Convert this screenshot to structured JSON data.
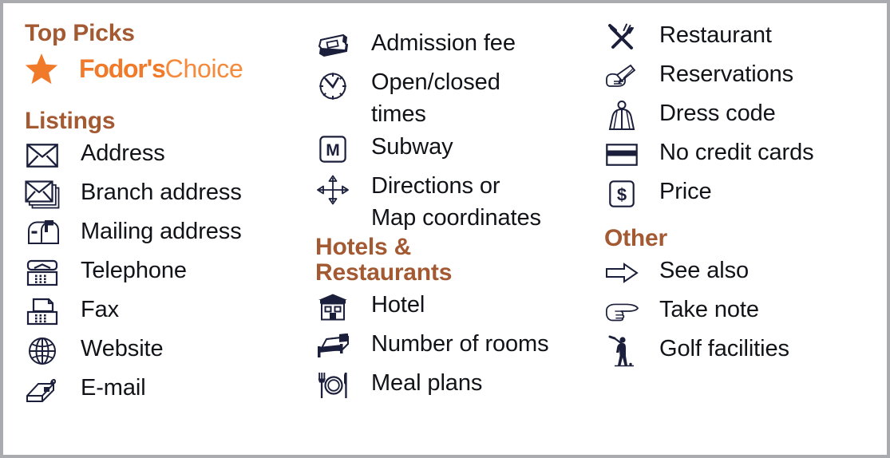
{
  "card": {
    "border_color": "#a9abaf",
    "background": "#ffffff",
    "heading_color": "#a35a32",
    "brand_orange": "#f1792a",
    "label_color": "#111318"
  },
  "columns": [
    {
      "id": "column-listings",
      "sections": [
        {
          "id": "top-picks",
          "title": "Top Picks",
          "brand": {
            "star_icon": "star-icon",
            "wordmark_bold": "Fodor's",
            "wordmark_light": "Choice"
          }
        },
        {
          "id": "listings",
          "title": "Listings",
          "items": [
            {
              "icon": "envelope-icon",
              "label": "Address"
            },
            {
              "icon": "envelope-stack-icon",
              "label": "Branch address"
            },
            {
              "icon": "mailbox-icon",
              "label": "Mailing address"
            },
            {
              "icon": "telephone-icon",
              "label": "Telephone"
            },
            {
              "icon": "fax-machine-icon",
              "label": "Fax"
            },
            {
              "icon": "globe-icon",
              "label": "Website"
            },
            {
              "icon": "computer-mouse-icon",
              "label": "E-mail"
            }
          ]
        }
      ]
    },
    {
      "id": "column-sights",
      "sections": [
        {
          "id": "sights",
          "title": "",
          "items": [
            {
              "icon": "ticket-icon",
              "label": "Admission fee"
            },
            {
              "icon": "clock-icon",
              "label": "Open/closed\ntimes"
            },
            {
              "icon": "subway-m-icon",
              "label": "Subway"
            },
            {
              "icon": "four-way-arrow-icon",
              "label": "Directions or\nMap coordinates"
            }
          ]
        },
        {
          "id": "hotels-restaurants",
          "title": "Hotels &\nRestaurants",
          "items": [
            {
              "icon": "hotel-building-icon",
              "label": "Hotel"
            },
            {
              "icon": "bed-icon",
              "label": "Number of rooms"
            },
            {
              "icon": "fork-plate-knife-icon",
              "label": "Meal plans"
            }
          ]
        }
      ]
    },
    {
      "id": "column-restaurants-other",
      "sections": [
        {
          "id": "restaurant-details",
          "title": "",
          "items": [
            {
              "icon": "crossed-fork-knife-icon",
              "label": "Restaurant"
            },
            {
              "icon": "writing-hand-icon",
              "label": "Reservations"
            },
            {
              "icon": "dress-code-person-icon",
              "label": "Dress code"
            },
            {
              "icon": "credit-card-icon",
              "label": "No credit cards"
            },
            {
              "icon": "dollar-sign-icon",
              "label": "Price"
            }
          ]
        },
        {
          "id": "other",
          "title": "Other",
          "items": [
            {
              "icon": "right-arrow-icon",
              "label": "See also"
            },
            {
              "icon": "pointing-hand-icon",
              "label": "Take note"
            },
            {
              "icon": "golfer-icon",
              "label": "Golf facilities"
            }
          ]
        }
      ]
    }
  ]
}
